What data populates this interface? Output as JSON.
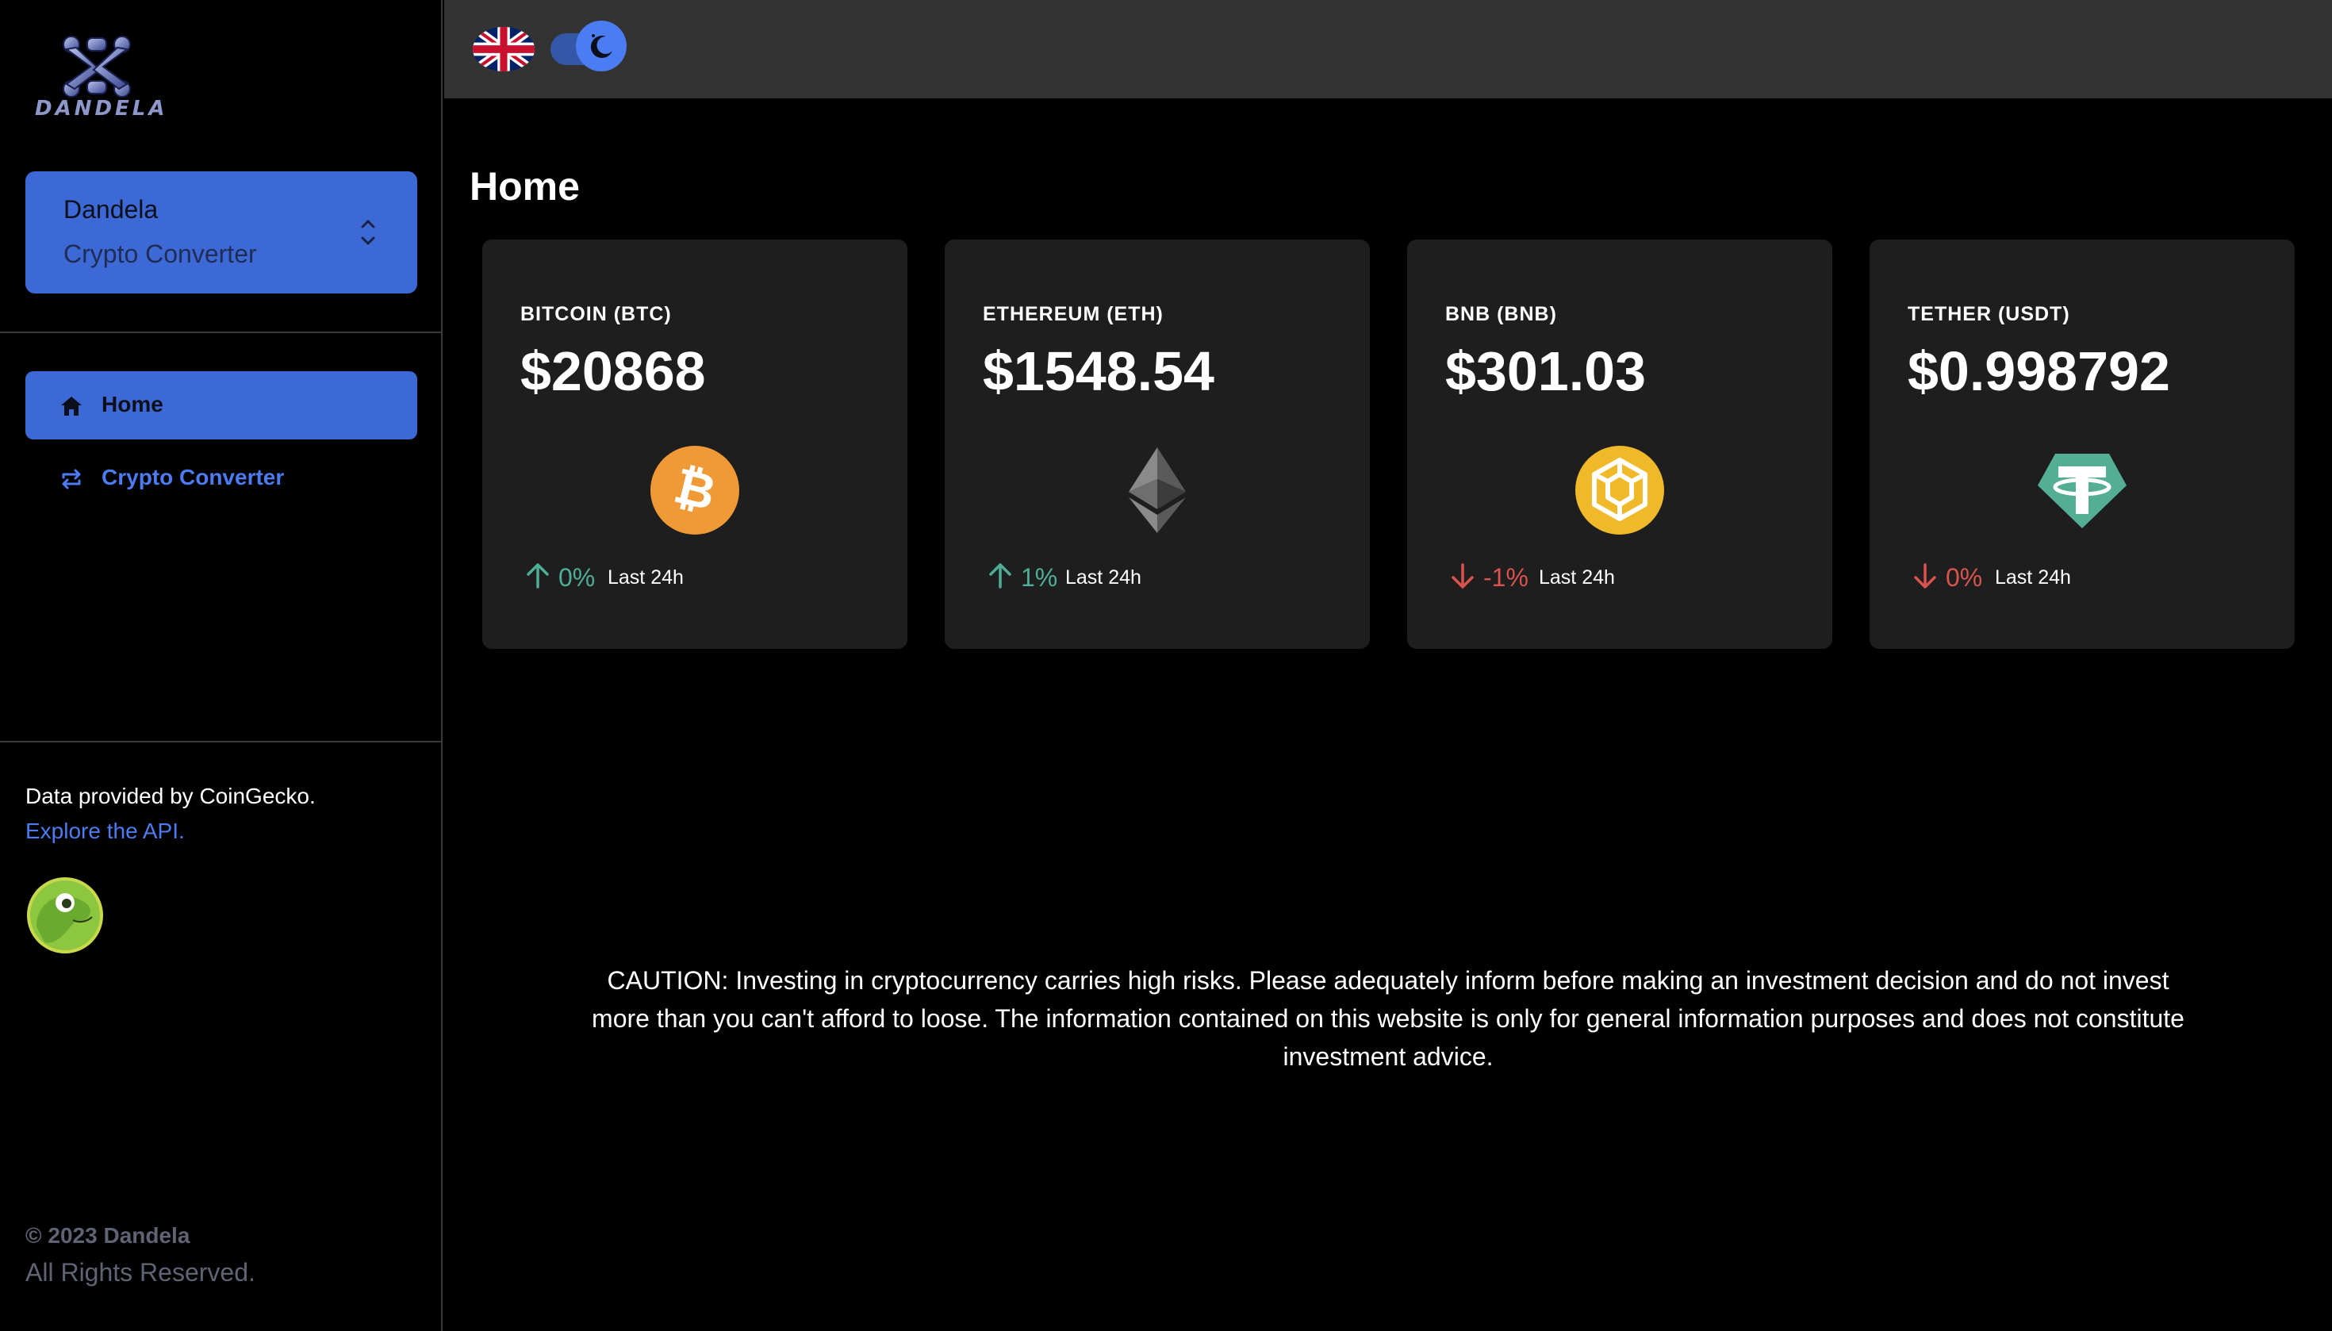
{
  "sidebar": {
    "logo_text": "DANDELA",
    "team": {
      "name": "Dandela",
      "subtitle": "Crypto Converter"
    },
    "nav": [
      {
        "label": "Home",
        "icon": "home-icon",
        "active": true
      },
      {
        "label": "Crypto Converter",
        "icon": "swap-arrows-icon",
        "active": false
      }
    ],
    "data_provided": "Data provided by CoinGecko.",
    "api_link": "Explore the API.",
    "copyright": "© 2023 Dandela",
    "rights": "All Rights Reserved."
  },
  "topbar": {
    "language_icon": "uk-flag-icon",
    "theme_toggle_icon": "moon-icon",
    "theme": "dark"
  },
  "main": {
    "title": "Home",
    "period_label": "Last 24h",
    "cards": [
      {
        "name": "BITCOIN (BTC)",
        "price": "$20868",
        "change": "0%",
        "direction": "up",
        "icon": "bitcoin-icon",
        "color": "#f09a37"
      },
      {
        "name": "ETHEREUM (ETH)",
        "price": "$1548.54",
        "change": "1%",
        "direction": "up",
        "icon": "ethereum-icon",
        "color": "#6e6e6e"
      },
      {
        "name": "BNB (BNB)",
        "price": "$301.03",
        "change": "-1%",
        "direction": "down",
        "icon": "bnb-icon",
        "color": "#f0b929"
      },
      {
        "name": "TETHER (USDT)",
        "price": "$0.998792",
        "change": "0%",
        "direction": "down",
        "icon": "tether-icon",
        "color": "#54ae94"
      }
    ],
    "caution": "CAUTION: Investing in cryptocurrency carries high risks. Please adequately inform before making an investment decision and do not invest more than you can't afford to loose. The information contained on this website is only for general information purposes and does not constitute investment advice."
  },
  "colors": {
    "accent": "#3d69d6",
    "link": "#4c7cf2",
    "up": "#4fae96",
    "down": "#d9534f",
    "card_bg": "#1e1e1e",
    "topbar_bg": "#333333"
  }
}
